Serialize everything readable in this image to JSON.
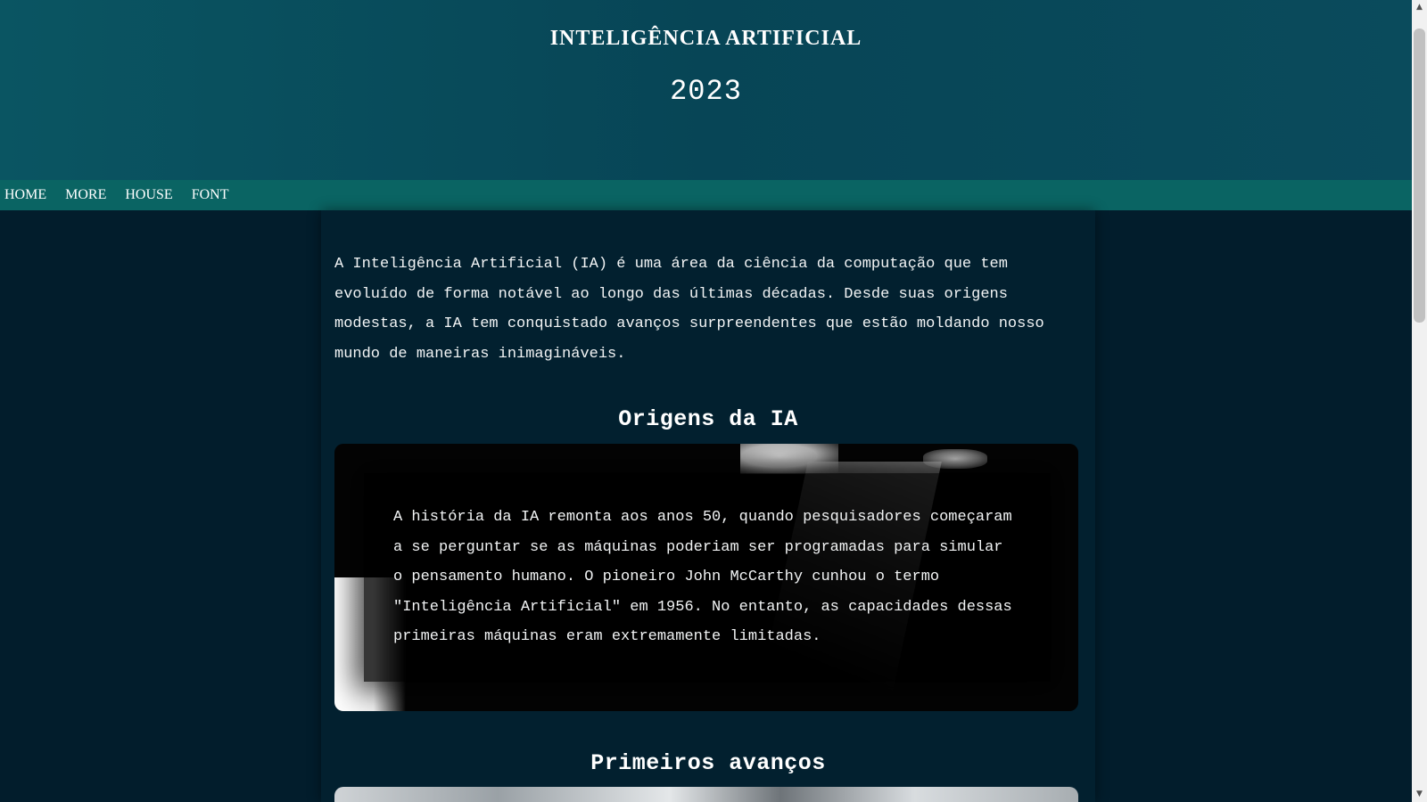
{
  "header": {
    "title": "INTELIGÊNCIA ARTIFICIAL",
    "year": "2023"
  },
  "nav": {
    "items": [
      {
        "label": "HOME"
      },
      {
        "label": "MORE"
      },
      {
        "label": "HOUSE"
      },
      {
        "label": "FONT"
      }
    ]
  },
  "main": {
    "intro": "A Inteligência Artificial (IA) é uma área da ciência da computação que tem evoluído de forma notável ao longo das últimas décadas. Desde suas origens modestas, a IA tem conquistado avanços surpreendentes que estão moldando nosso mundo de maneiras inimagináveis.",
    "sections": [
      {
        "title": "Origens da IA",
        "text": "A história da IA remonta aos anos 50, quando pesquisadores começaram a se perguntar se as máquinas poderiam ser programadas para simular o pensamento humano. O pioneiro John McCarthy cunhou o termo \"Inteligência Artificial\" em 1956. No entanto, as capacidades dessas primeiras máquinas eram extremamente limitadas."
      },
      {
        "title": "Primeiros avanços"
      }
    ]
  },
  "colors": {
    "header_bg": "#074556",
    "nav_bg": "#0a6463",
    "page_bg": "#021d2c",
    "text": "#ffffff"
  },
  "icons": {
    "scroll_up": "triangle-up-icon",
    "scroll_down": "triangle-down-icon"
  }
}
